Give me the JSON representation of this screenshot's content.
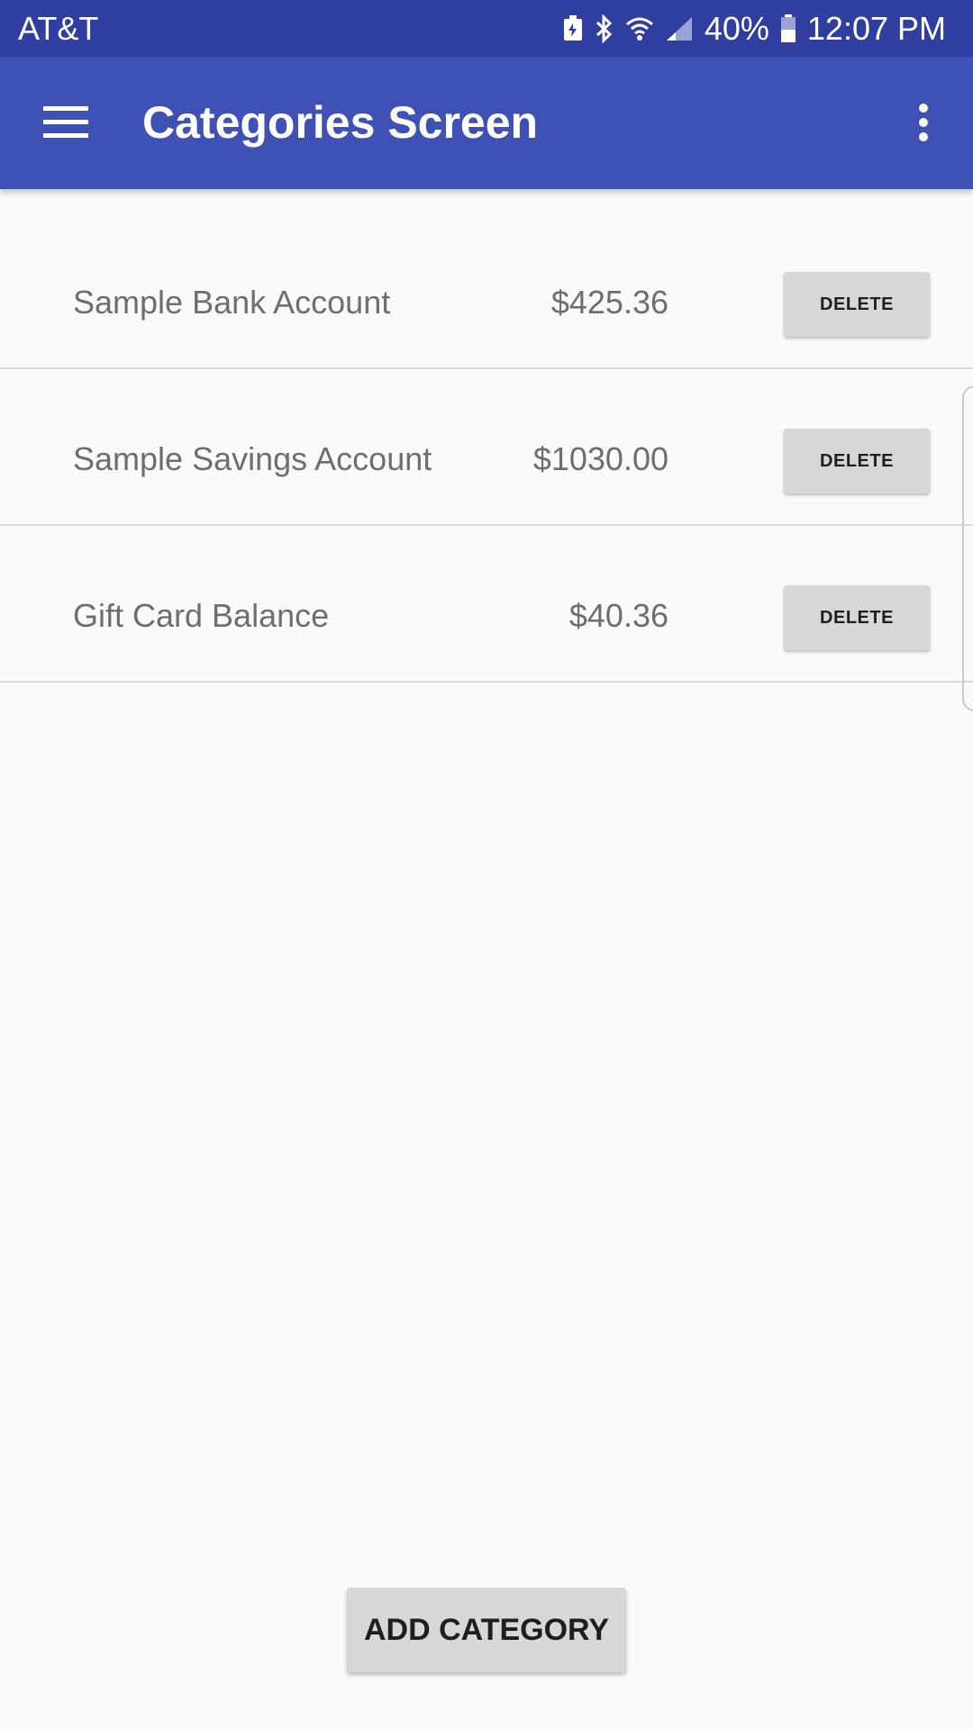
{
  "status_bar": {
    "carrier": "AT&T",
    "battery_percent": "40%",
    "time": "12:07 PM",
    "icons": [
      "battery-saver-icon",
      "bluetooth-icon",
      "wifi-icon",
      "cell-signal-icon",
      "battery-icon"
    ]
  },
  "app_bar": {
    "title": "Categories Screen",
    "menu_icon": "hamburger-menu-icon",
    "overflow_icon": "more-vert-icon",
    "background": "#3f51b5"
  },
  "categories": [
    {
      "name": "Sample Bank Account",
      "amount": "$425.36",
      "delete_label": "DELETE"
    },
    {
      "name": "Sample Savings Account",
      "amount": "$1030.00",
      "delete_label": "DELETE"
    },
    {
      "name": "Gift Card Balance",
      "amount": "$40.36",
      "delete_label": "DELETE"
    }
  ],
  "add_button": {
    "label": "ADD CATEGORY"
  }
}
